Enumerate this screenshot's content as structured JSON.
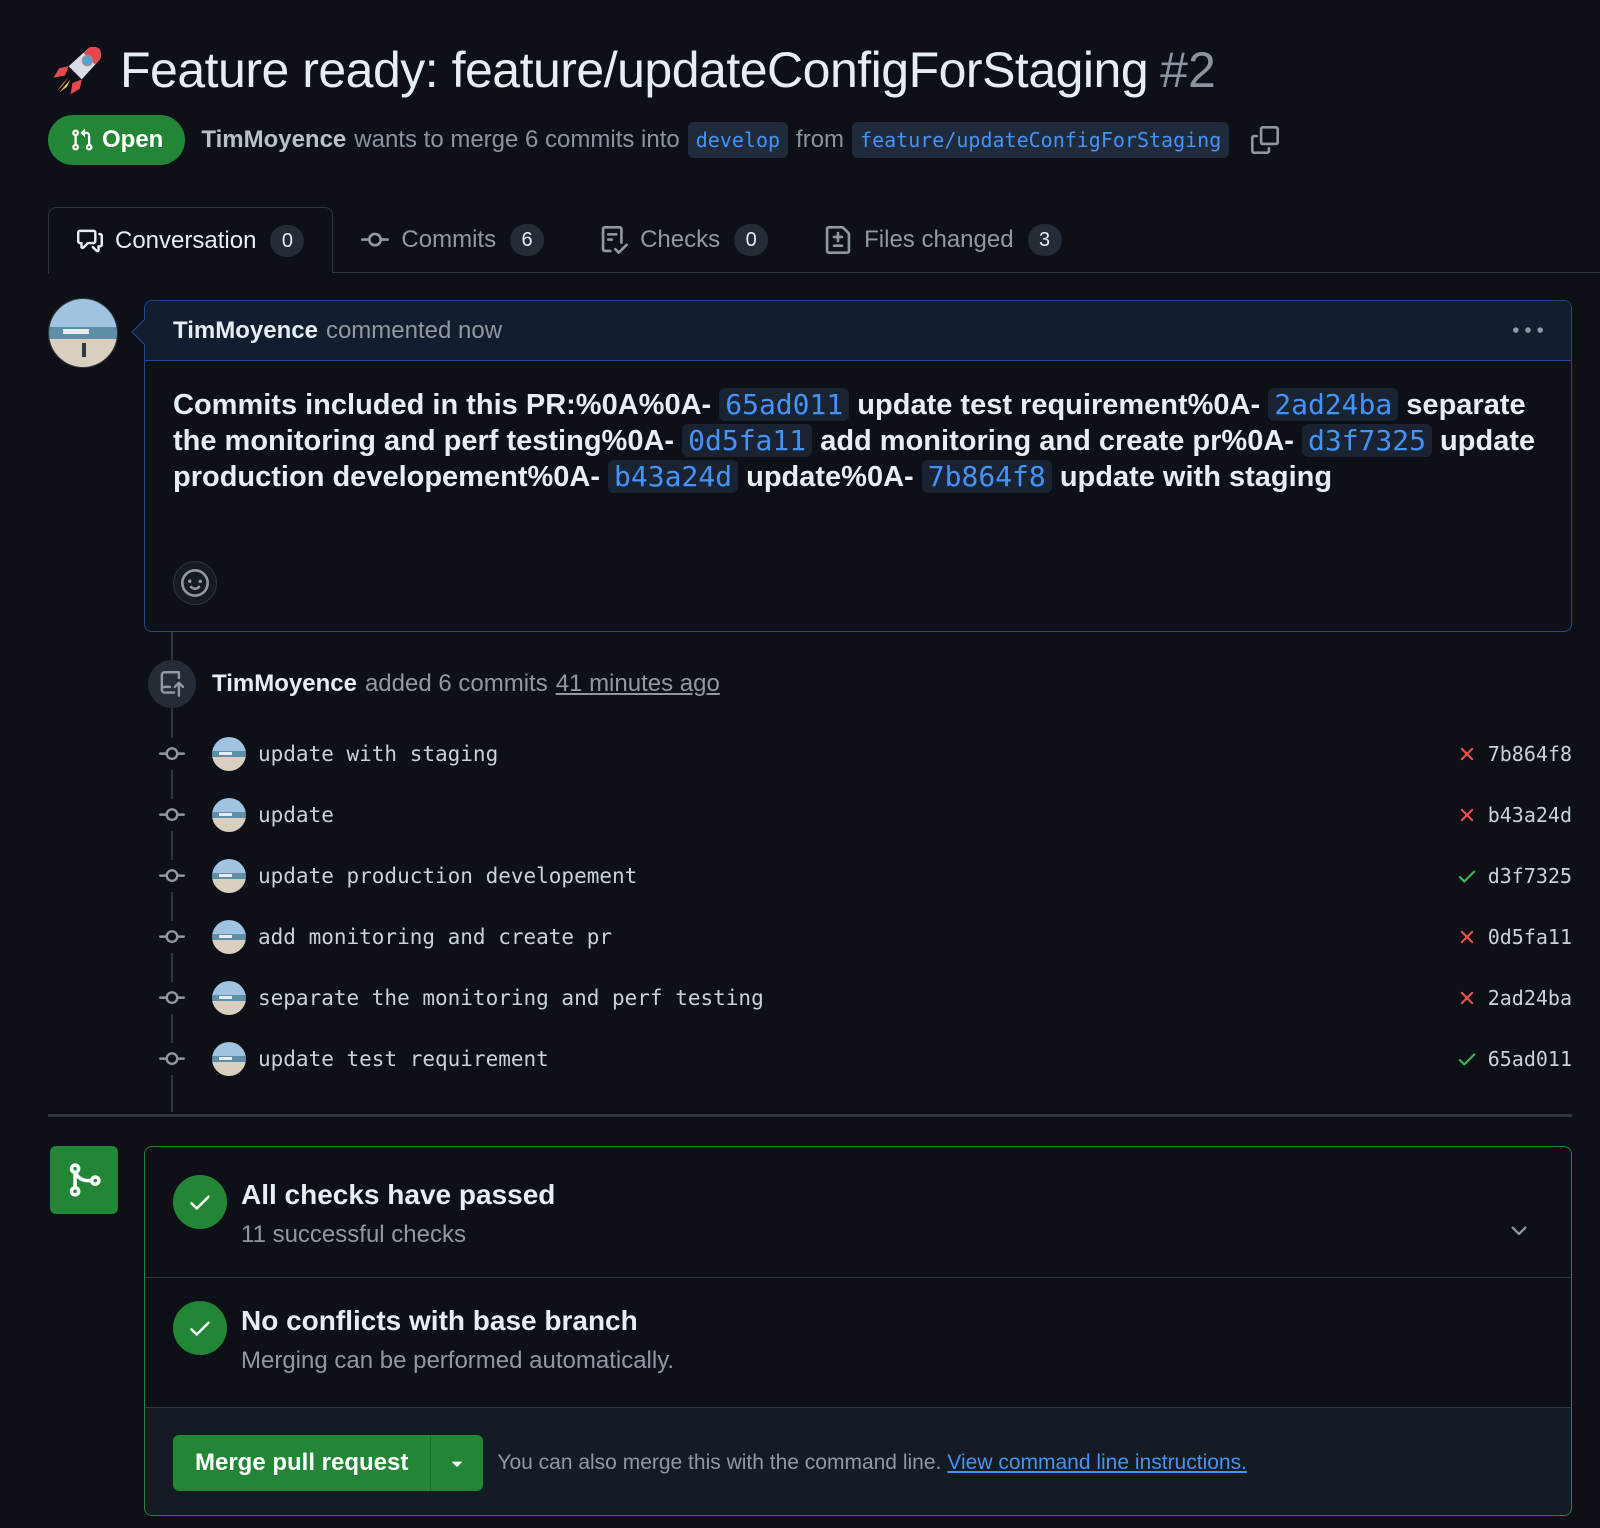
{
  "header": {
    "title": "Feature ready: feature/updateConfigForStaging",
    "number": "#2",
    "state": "Open",
    "author": "TimMoyence",
    "merge_text": "wants to merge 6 commits into",
    "base_branch": "develop",
    "from_text": "from",
    "head_branch": "feature/updateConfigForStaging"
  },
  "tabs": [
    {
      "label": "Conversation",
      "count": "0"
    },
    {
      "label": "Commits",
      "count": "6"
    },
    {
      "label": "Checks",
      "count": "0"
    },
    {
      "label": "Files changed",
      "count": "3"
    }
  ],
  "comment": {
    "author": "TimMoyence",
    "action": "commented now",
    "body": {
      "p1": "Commits included in this PR:%0A%0A- ",
      "s1": "65ad011",
      "p2": " update test requirement%0A- ",
      "s2": "2ad24ba",
      "p3": " separate the monitoring and perf testing%0A- ",
      "s3": "0d5fa11",
      "p4": " add monitoring and create pr%0A- ",
      "s4": "d3f7325",
      "p5": " update production developement%0A- ",
      "s5": "b43a24d",
      "p6": " update%0A- ",
      "s6": "7b864f8",
      "p7": " update with staging"
    }
  },
  "push_event": {
    "author": "TimMoyence",
    "action": "added 6 commits",
    "time": "41 minutes ago"
  },
  "commits": [
    {
      "message": "update with staging",
      "sha": "7b864f8",
      "status": "failure"
    },
    {
      "message": "update",
      "sha": "b43a24d",
      "status": "failure"
    },
    {
      "message": "update production developement",
      "sha": "d3f7325",
      "status": "success"
    },
    {
      "message": "add monitoring and create pr",
      "sha": "0d5fa11",
      "status": "failure"
    },
    {
      "message": "separate the monitoring and perf testing",
      "sha": "2ad24ba",
      "status": "failure"
    },
    {
      "message": "update test requirement",
      "sha": "65ad011",
      "status": "success"
    }
  ],
  "merge_box": {
    "checks_title": "All checks have passed",
    "checks_sub": "11 successful checks",
    "conflicts_title": "No conflicts with base branch",
    "conflicts_sub": "Merging can be performed automatically.",
    "merge_button": "Merge pull request",
    "footer_text": "You can also merge this with the command line.",
    "footer_link": "View command line instructions."
  },
  "colors": {
    "accent_green": "#238636",
    "link_blue": "#4493f8",
    "failure_red": "#f85149",
    "success_green": "#3fb950"
  }
}
